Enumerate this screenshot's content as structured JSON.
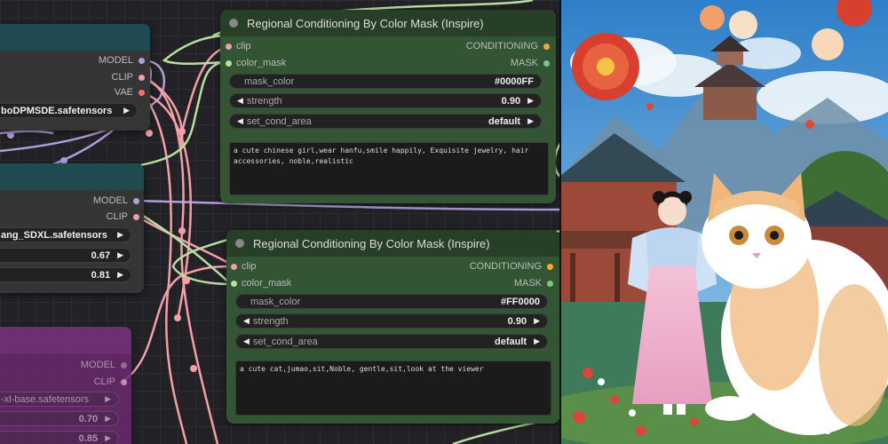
{
  "node_top_left": {
    "outputs": [
      "MODEL",
      "CLIP",
      "VAE"
    ],
    "ckpt_value": "boDPMSDE.safetensors"
  },
  "node_mid_left": {
    "outputs": [
      "MODEL",
      "CLIP"
    ],
    "lora_value": "ang_SDXL.safetensors",
    "strength_model": "0.67",
    "strength_clip": "0.81"
  },
  "node_bottom_left": {
    "outputs": [
      "MODEL",
      "CLIP"
    ],
    "ckpt_value": "-xl-base.safetensors",
    "value1": "0.70",
    "value2": "0.85"
  },
  "regional_1": {
    "title": "Regional Conditioning By Color Mask (Inspire)",
    "inputs": [
      "clip",
      "color_mask"
    ],
    "outputs": [
      "CONDITIONING",
      "MASK"
    ],
    "mask_color_label": "mask_color",
    "mask_color_value": "#0000FF",
    "strength_label": "strength",
    "strength_value": "0.90",
    "set_cond_area_label": "set_cond_area",
    "set_cond_area_value": "default",
    "prompt": "a cute chinese girl,wear hanfu,smile happily, Exquisite jewelry, hair accessories, noble,realistic"
  },
  "regional_2": {
    "title": "Regional Conditioning By Color Mask (Inspire)",
    "inputs": [
      "clip",
      "color_mask"
    ],
    "outputs": [
      "CONDITIONING",
      "MASK"
    ],
    "mask_color_label": "mask_color",
    "mask_color_value": "#FF0000",
    "strength_label": "strength",
    "strength_value": "0.90",
    "set_cond_area_label": "set_cond_area",
    "set_cond_area_value": "default",
    "prompt": "a cute cat,jumao,sit,Noble, gentle,sit,look at the viewer"
  },
  "colors": {
    "model_socket": "#b39ddb",
    "clip_socket": "#f2a0a8",
    "vae_socket": "#ff6e6e",
    "mask_socket": "#81c784",
    "conditioning_socket": "#ffa931",
    "wire_green": "#b6e0a0",
    "wire_pink": "#f2a0a8",
    "wire_purple": "#b39ddb"
  }
}
